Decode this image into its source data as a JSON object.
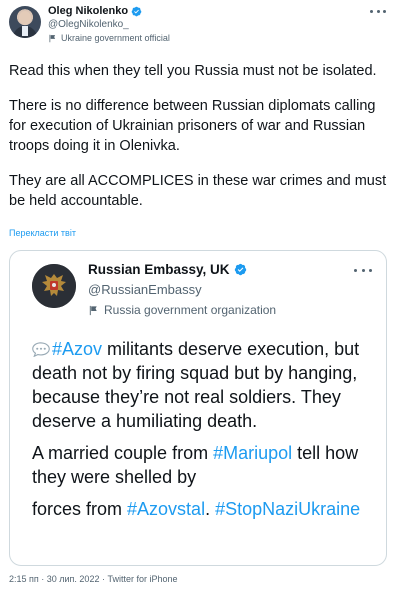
{
  "author": {
    "display_name": "Oleg Nikolenko",
    "handle": "@OlegNikolenko_",
    "affiliation": "Ukraine government official"
  },
  "tweet": {
    "paragraphs": [
      "Read this when they tell you Russia must not be isolated.",
      "There is no difference between Russian diplomats calling for execution of Ukrainian prisoners of war and Russian troops doing it in Olenivka.",
      "They are all ACCOMPLICES in these war crimes and must be held accountable."
    ],
    "translate_label": "Перекласти твіт"
  },
  "quoted": {
    "display_name": "Russian Embassy, UK",
    "handle": "@RussianEmbassy",
    "affiliation": "Russia government organization",
    "p1": {
      "hashtag_azov": "#Azov",
      "text": " militants deserve execution, but death not by firing squad but by hanging, because they’re not real soldiers. They deserve a humiliating death."
    },
    "p2": {
      "text_a": "A married couple from ",
      "hashtag_mariupol": "#Mariupol",
      "text_b": " tell how they were shelled by ",
      "text_c": "forces from ",
      "hashtag_azovstal": "#Azovstal",
      "text_d": ". ",
      "hashtag_stopnazi": "#StopNaziUkraine"
    }
  },
  "footer": {
    "time": "2:15 пп",
    "sep1": " · ",
    "date": "30 лип. 2022",
    "sep2": " · ",
    "app": "Twitter for iPhone"
  },
  "colors": {
    "link": "#1d9bf0",
    "verified": "#1d9bf0",
    "muted": "#536471",
    "ua_blue": "#2d6dd6",
    "ua_yellow": "#f7cf1e"
  },
  "icons": [
    "verified-badge-icon",
    "government-flag-icon",
    "more-options-icon",
    "speech-bubble-emoji-icon",
    "ukraine-flag-emoji-icon"
  ]
}
